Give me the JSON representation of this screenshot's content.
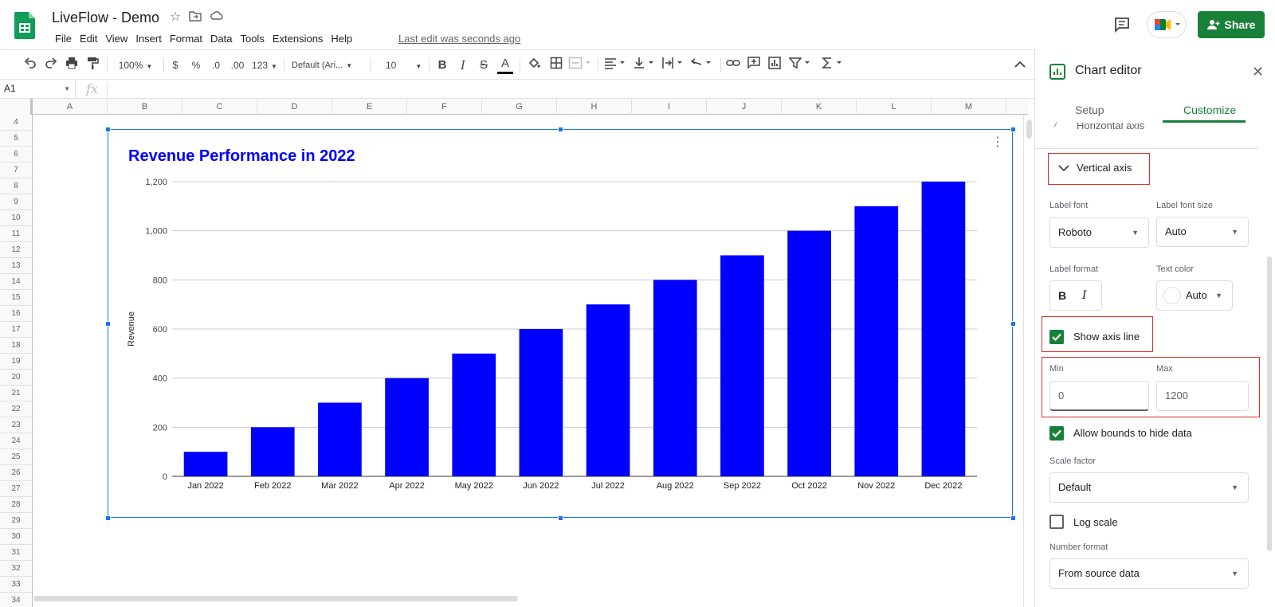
{
  "app": {
    "title": "LiveFlow - Demo",
    "last_edit": "Last edit was seconds ago",
    "share_label": "Share",
    "menu": [
      "File",
      "Edit",
      "View",
      "Insert",
      "Format",
      "Data",
      "Tools",
      "Extensions",
      "Help"
    ]
  },
  "toolbar": {
    "zoom": "100%",
    "currency": "$",
    "percent": "%",
    "decrease_decimal": ".0",
    "increase_decimal": ".00",
    "more_formats": "123",
    "font": "Default (Ari...",
    "font_size": "10",
    "bold": "B",
    "italic": "I",
    "strike": "S",
    "text_color": "A"
  },
  "formula_bar": {
    "cell_ref": "A1",
    "fx": "fx"
  },
  "grid": {
    "columns": [
      "A",
      "B",
      "C",
      "D",
      "E",
      "F",
      "G",
      "H",
      "I",
      "J",
      "K",
      "L",
      "M"
    ],
    "rows": [
      "4",
      "5",
      "6",
      "7",
      "8",
      "9",
      "10",
      "11",
      "12",
      "13",
      "14",
      "15",
      "16",
      "17",
      "18",
      "19",
      "20",
      "21",
      "22",
      "23",
      "24",
      "25",
      "26",
      "27",
      "28",
      "29",
      "30",
      "31",
      "32",
      "33",
      "34"
    ]
  },
  "chart_data": {
    "type": "bar",
    "title": "Revenue Performance in 2022",
    "xlabel": "",
    "ylabel": "Revenue",
    "ylim": [
      0,
      1200
    ],
    "yticks": [
      "0",
      "200",
      "400",
      "600",
      "800",
      "1,000",
      "1,200"
    ],
    "categories": [
      "Jan 2022",
      "Feb 2022",
      "Mar 2022",
      "Apr 2022",
      "May 2022",
      "Jun 2022",
      "Jul 2022",
      "Aug 2022",
      "Sep 2022",
      "Oct 2022",
      "Nov 2022",
      "Dec 2022"
    ],
    "values": [
      100,
      200,
      300,
      400,
      500,
      600,
      700,
      800,
      900,
      1000,
      1100,
      1200
    ],
    "bar_color": "#0000ff",
    "title_color": "#0000ff",
    "grid": true,
    "legend": "none"
  },
  "panel": {
    "title": "Chart editor",
    "tabs": [
      "Setup",
      "Customize"
    ],
    "active_tab": "Customize",
    "prev_section": "Horizontal axis",
    "section": "Vertical axis",
    "label_font_label": "Label font",
    "label_font_value": "Roboto",
    "label_font_size_label": "Label font size",
    "label_font_size_value": "Auto",
    "label_format_label": "Label format",
    "text_color_label": "Text color",
    "text_color_value": "Auto",
    "show_axis_line": "Show axis line",
    "min_label": "Min",
    "min_value": "0",
    "max_label": "Max",
    "max_value": "1200",
    "allow_bounds": "Allow bounds to hide data",
    "scale_factor_label": "Scale factor",
    "scale_factor_value": "Default",
    "log_scale": "Log scale",
    "number_format_label": "Number format",
    "number_format_value": "From source data",
    "accent_color": "#188038",
    "highlight_color": "#d93025"
  }
}
